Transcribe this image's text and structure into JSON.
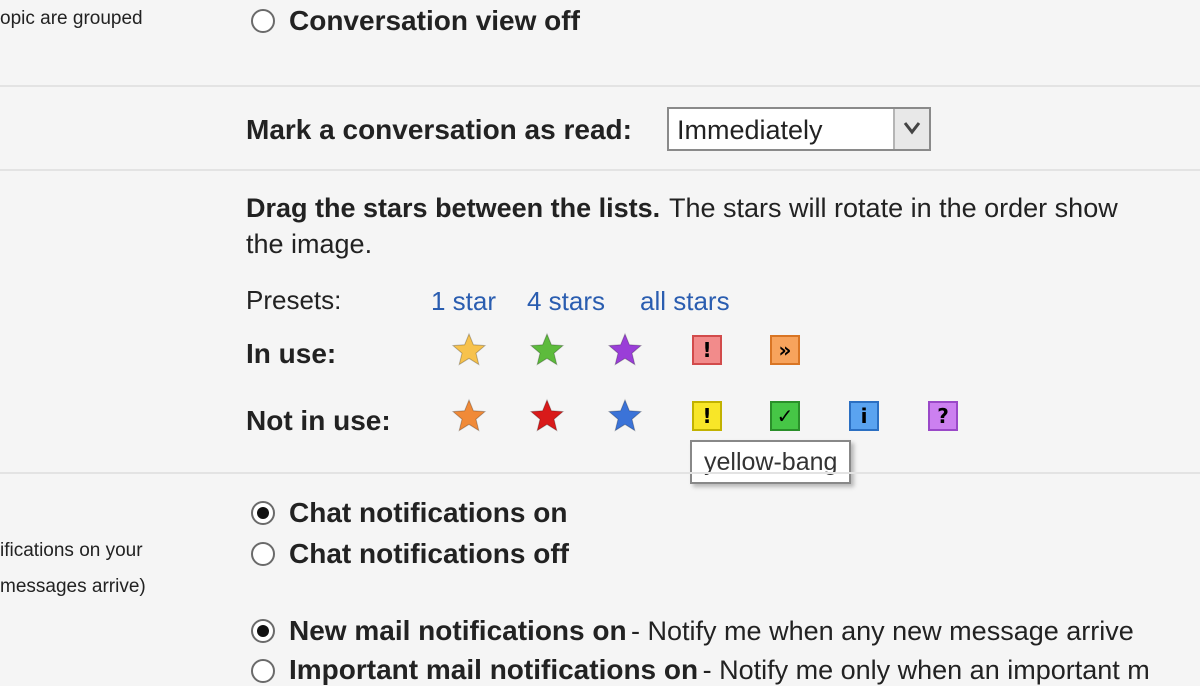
{
  "conversation_view": {
    "side_text": "opic are grouped",
    "option_off_label": "Conversation view off"
  },
  "mark_read": {
    "label": "Mark a conversation as read:",
    "selected": "Immediately"
  },
  "stars": {
    "instruction_bold": "Drag the stars between the lists.",
    "instruction_rest": "The stars will rotate in the order show",
    "instruction_line2": "the image.",
    "presets_label": "Presets:",
    "presets": [
      "1 star",
      "4 stars",
      "all stars"
    ],
    "in_use_label": "In use:",
    "not_in_use_label": "Not in use:",
    "in_use": [
      {
        "icon": "yellow-star",
        "color": "#f7c24d"
      },
      {
        "icon": "green-star",
        "color": "#5dbb3c"
      },
      {
        "icon": "purple-star",
        "color": "#9a3ed8"
      },
      {
        "icon": "red-bang",
        "glyph": "!",
        "bg": "#f28b8b",
        "border": "#d24b4b"
      },
      {
        "icon": "orange-guillemet",
        "glyph": "»",
        "bg": "#f7a35c",
        "border": "#d97524"
      }
    ],
    "not_in_use": [
      {
        "icon": "orange-star",
        "color": "#f08a38"
      },
      {
        "icon": "red-star",
        "color": "#d91a1a"
      },
      {
        "icon": "blue-star",
        "color": "#3b73d8"
      },
      {
        "icon": "yellow-bang",
        "glyph": "!",
        "bg": "#f8e628",
        "border": "#c2b200"
      },
      {
        "icon": "green-check",
        "glyph": "✓",
        "bg": "#46c646",
        "border": "#2a8f2a"
      },
      {
        "icon": "blue-info",
        "glyph": "i",
        "bg": "#5aa3f0",
        "border": "#2b6fc2"
      },
      {
        "icon": "purple-question",
        "glyph": "?",
        "bg": "#cc80f0",
        "border": "#9a48c8"
      }
    ],
    "tooltip": "yellow-bang"
  },
  "chat_notifications": {
    "side_line1": "ifications on your",
    "side_line2": "messages arrive)",
    "on_label": "Chat notifications on",
    "off_label": "Chat notifications off",
    "selected": "on"
  },
  "mail_notifications": {
    "new_label": "New mail notifications on",
    "new_desc": "- Notify me when any new message arrive",
    "important_label": "Important mail notifications on",
    "important_desc": "- Notify me only when an important m"
  }
}
